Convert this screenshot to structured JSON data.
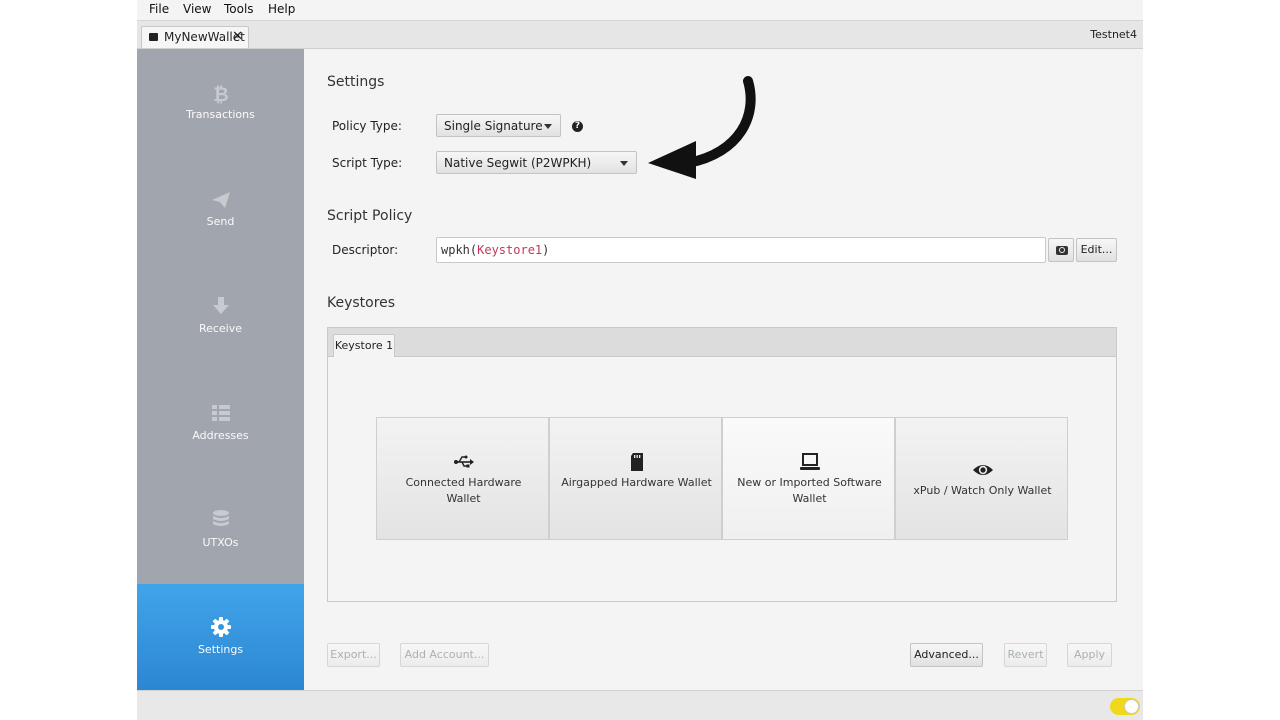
{
  "menu": {
    "items": [
      "File",
      "View",
      "Tools",
      "Help"
    ]
  },
  "tabs": {
    "wallet_name": "MyNewWallet",
    "close": "✕",
    "network": "Testnet4"
  },
  "sidebar": {
    "items": [
      {
        "label": "Transactions",
        "icon": "bitcoin-icon"
      },
      {
        "label": "Send",
        "icon": "send-icon"
      },
      {
        "label": "Receive",
        "icon": "receive-icon"
      },
      {
        "label": "Addresses",
        "icon": "addresses-icon"
      },
      {
        "label": "UTXOs",
        "icon": "utxos-icon"
      },
      {
        "label": "Settings",
        "icon": "gear-icon",
        "active": true
      }
    ],
    "active_color": "#2c86d2"
  },
  "settings": {
    "title": "Settings",
    "policy_type_label": "Policy Type:",
    "policy_type_value": "Single Signature",
    "script_type_label": "Script Type:",
    "script_type_value": "Native Segwit (P2WPKH)"
  },
  "script_policy": {
    "title": "Script Policy",
    "descriptor_label": "Descriptor:",
    "descriptor_fn": "wpkh(",
    "descriptor_arg": "Keystore1",
    "descriptor_close": ")",
    "edit_label": "Edit..."
  },
  "keystores": {
    "title": "Keystores",
    "tab_label": "Keystore 1",
    "options": [
      {
        "label": "Connected Hardware Wallet",
        "icon": "usb-icon"
      },
      {
        "label": "Airgapped Hardware Wallet",
        "icon": "sd-card-icon"
      },
      {
        "label": "New or Imported Software Wallet",
        "icon": "laptop-icon"
      },
      {
        "label": "xPub / Watch Only Wallet",
        "icon": "eye-icon"
      }
    ]
  },
  "footer": {
    "export_label": "Export...",
    "add_account_label": "Add Account...",
    "advanced_label": "Advanced...",
    "revert_label": "Revert",
    "apply_label": "Apply"
  }
}
